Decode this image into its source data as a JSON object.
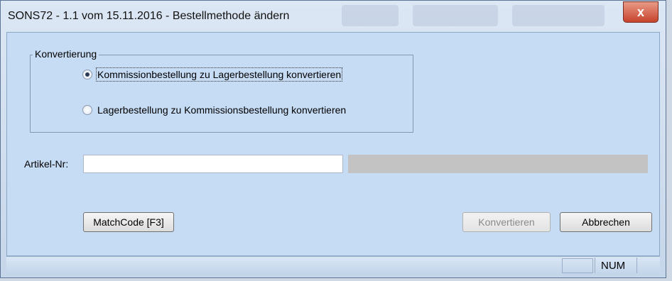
{
  "window": {
    "title": "SONS72 - 1.1 vom 15.11.2016 - Bestellmethode ändern",
    "close_glyph": "x"
  },
  "group": {
    "legend": "Konvertierung",
    "options": [
      {
        "label": "Kommissionbestellung zu Lagerbestellung konvertieren",
        "checked": true
      },
      {
        "label": "Lagerbestellung zu Kommissionsbestellung konvertieren",
        "checked": false
      }
    ]
  },
  "article": {
    "label": "Artikel-Nr:",
    "value": ""
  },
  "buttons": {
    "matchcode": "MatchCode [F3]",
    "convert": "Konvertieren",
    "cancel": "Abbrechen"
  },
  "status": {
    "num": "NUM"
  },
  "colors": {
    "client_bg": "#c6dcf5",
    "close_red": "#c7432c"
  }
}
